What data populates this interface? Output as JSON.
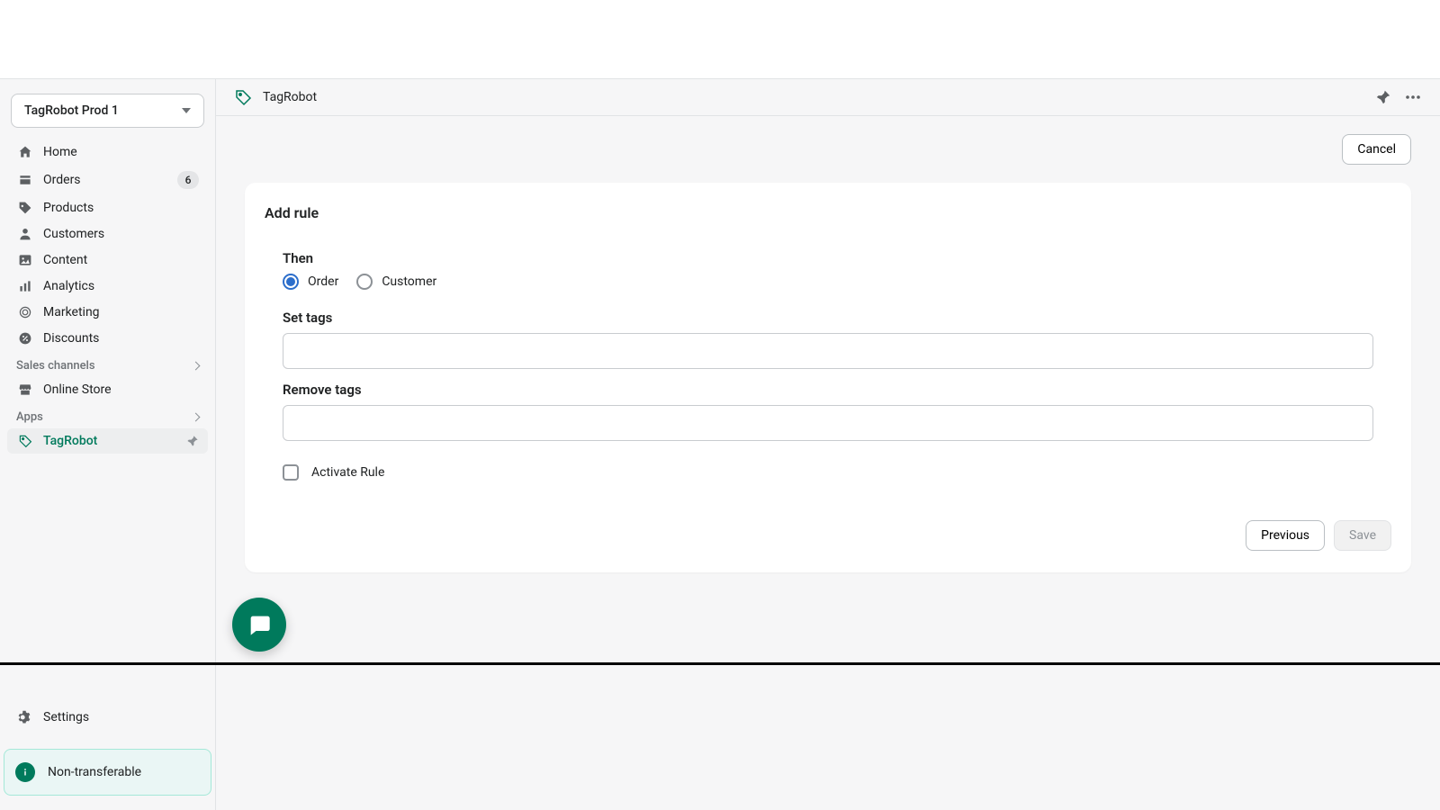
{
  "store_name": "TagRobot Prod 1",
  "sidebar": {
    "items": [
      {
        "label": "Home"
      },
      {
        "label": "Orders",
        "badge": "6"
      },
      {
        "label": "Products"
      },
      {
        "label": "Customers"
      },
      {
        "label": "Content"
      },
      {
        "label": "Analytics"
      },
      {
        "label": "Marketing"
      },
      {
        "label": "Discounts"
      }
    ],
    "sales_channels_label": "Sales channels",
    "online_store_label": "Online Store",
    "apps_label": "Apps",
    "app_item_label": "TagRobot",
    "settings_label": "Settings",
    "banner_label": "Non-transferable"
  },
  "app_header": {
    "name": "TagRobot"
  },
  "actions": {
    "cancel": "Cancel"
  },
  "form": {
    "title": "Add rule",
    "then_label": "Then",
    "radio_order": "Order",
    "radio_customer": "Customer",
    "set_tags_label": "Set tags",
    "set_tags_value": "",
    "remove_tags_label": "Remove tags",
    "remove_tags_value": "",
    "activate_label": "Activate Rule"
  },
  "footer": {
    "previous": "Previous",
    "save": "Save"
  }
}
